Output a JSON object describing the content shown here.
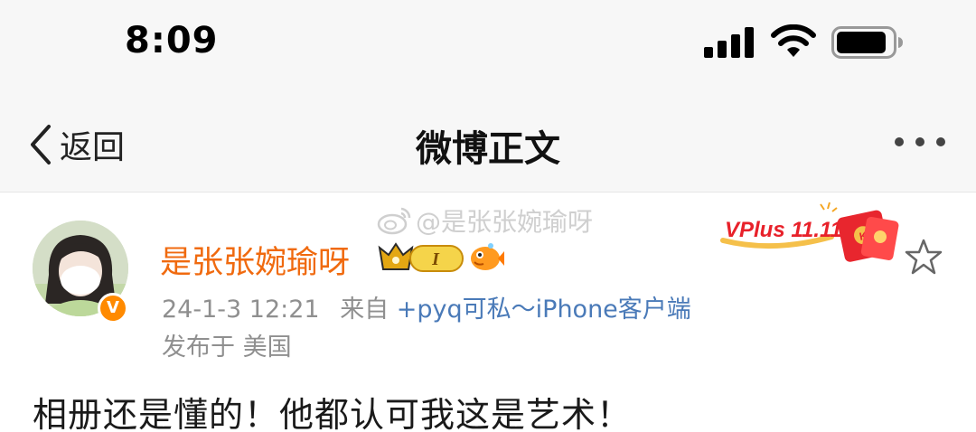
{
  "status_bar": {
    "time": "8:09",
    "icons": [
      "cellular-signal-icon",
      "wifi-icon",
      "battery-icon"
    ]
  },
  "nav": {
    "back_label": "返回",
    "title": "微博正文",
    "more_icon": "more-dots-icon"
  },
  "watermark": {
    "text": "@是张张婉瑜呀"
  },
  "post": {
    "author": "是张张婉瑜呀",
    "verified_icon": "verified-v-icon",
    "member_badge_level": "I",
    "time": "24-1-3 12:21",
    "source_prefix": "来自",
    "source": "+pyq可私～iPhone客户端",
    "region": "发布于 美国",
    "text": "相册还是懂的！他都认可我这是艺术！"
  },
  "promo": {
    "label": "VPlus 11.11"
  },
  "colors": {
    "username": "#f06a0f",
    "meta": "#8f8f8f",
    "client_link": "#4a7ab8",
    "verified": "#ff8a00",
    "header_bg": "#f7f7f7"
  }
}
